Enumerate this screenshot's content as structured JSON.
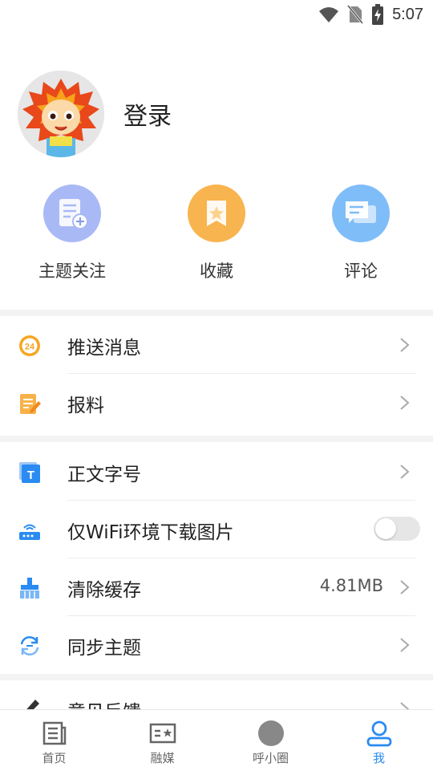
{
  "status_bar": {
    "time": "5:07",
    "icons": [
      "wifi-icon",
      "no-sim-icon",
      "battery-charging-icon"
    ]
  },
  "profile": {
    "login_label": "登录",
    "avatar_icon": "lion-mascot-avatar"
  },
  "shortcuts": [
    {
      "label": "主题关注",
      "icon": "topic-follow-icon",
      "color": "#a9b9f5"
    },
    {
      "label": "收藏",
      "icon": "bookmark-star-icon",
      "color": "#f8b44f"
    },
    {
      "label": "评论",
      "icon": "comment-icon",
      "color": "#7fbdf8"
    }
  ],
  "menu": {
    "push": {
      "label": "推送消息",
      "icon": "push-24-icon"
    },
    "report": {
      "label": "报料",
      "icon": "report-edit-icon"
    },
    "font_size": {
      "label": "正文字号",
      "icon": "text-size-icon"
    },
    "wifi_images": {
      "label": "仅WiFi环境下载图片",
      "icon": "router-icon",
      "enabled": false
    },
    "clear_cache": {
      "label": "清除缓存",
      "icon": "broom-icon",
      "value": "4.81MB"
    },
    "sync_topics": {
      "label": "同步主题",
      "icon": "sync-icon"
    },
    "feedback": {
      "label": "意见反馈",
      "icon": "pencil-icon"
    }
  },
  "tabs": [
    {
      "label": "首页",
      "icon": "newspaper-icon",
      "active": false
    },
    {
      "label": "融媒",
      "icon": "media-card-icon",
      "active": false
    },
    {
      "label": "呼小圈",
      "icon": "circle-icon",
      "active": false
    },
    {
      "label": "我",
      "icon": "user-icon",
      "active": true
    }
  ],
  "colors": {
    "accent": "#2a8bf2",
    "divider": "#f3f3f3"
  }
}
